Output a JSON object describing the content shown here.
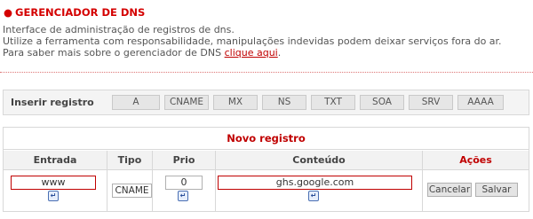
{
  "header": {
    "bullet": "●",
    "title": "GERENCIADOR DE DNS",
    "line1": "Interface de administração de registros de dns.",
    "line2": "Utilize a ferramenta com responsabilidade, manipulações indevidas podem deixar serviços fora do ar.",
    "line3_prefix": "Para saber mais sobre o gerenciador de DNS ",
    "line3_link": "clique aqui",
    "line3_suffix": "."
  },
  "insert_bar": {
    "label": "Inserir registro",
    "types": [
      "A",
      "CNAME",
      "MX",
      "NS",
      "TXT",
      "SOA",
      "SRV",
      "AAAA"
    ]
  },
  "form": {
    "title": "Novo registro",
    "columns": {
      "entrada": "Entrada",
      "tipo": "Tipo",
      "prio": "Prio",
      "conteudo": "Conteúdo",
      "acoes": "Ações"
    },
    "values": {
      "entrada": "www",
      "tipo": "CNAME",
      "prio": "0",
      "conteudo": "ghs.google.com"
    },
    "buttons": {
      "cancel": "Cancelar",
      "save": "Salvar"
    }
  },
  "colors": {
    "accent": "#c00000",
    "border": "#d8d8d8"
  },
  "icons": {
    "field_helper": "insert-tag-icon"
  }
}
